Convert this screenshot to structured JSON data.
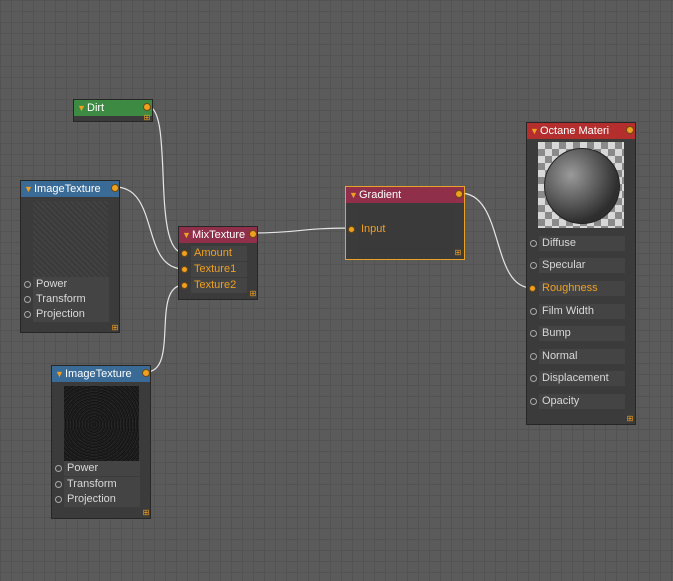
{
  "colors": {
    "grid_bg": "#5b5b5b",
    "port_orange": "#f0a020",
    "header_green": "#3d8a43",
    "header_blue": "#3a6b96",
    "header_red": "#8f2f4a",
    "header_crimson": "#b52e2e"
  },
  "nodes": {
    "dirt": {
      "title": "Dirt"
    },
    "image_texture_1": {
      "title": "ImageTexture",
      "inputs": [
        "Power",
        "Transform",
        "Projection"
      ]
    },
    "image_texture_2": {
      "title": "ImageTexture",
      "inputs": [
        "Power",
        "Transform",
        "Projection"
      ]
    },
    "mix_texture": {
      "title": "MixTexture",
      "inputs": [
        "Amount",
        "Texture1",
        "Texture2"
      ]
    },
    "gradient": {
      "title": "Gradient",
      "inputs": [
        "Input"
      ]
    },
    "octane_material": {
      "title": "Octane Materi",
      "inputs": [
        "Diffuse",
        "Specular",
        "Roughness",
        "Film Width",
        "Bump",
        "Normal",
        "Displacement",
        "Opacity"
      ]
    }
  },
  "connections": [
    {
      "from": "Dirt",
      "to": "MixTexture.Amount"
    },
    {
      "from": "ImageTexture",
      "to": "MixTexture.Texture1"
    },
    {
      "from": "ImageTexture",
      "to": "MixTexture.Texture2"
    },
    {
      "from": "MixTexture",
      "to": "Gradient.Input"
    },
    {
      "from": "Gradient",
      "to": "Octane Materi.Roughness"
    }
  ]
}
